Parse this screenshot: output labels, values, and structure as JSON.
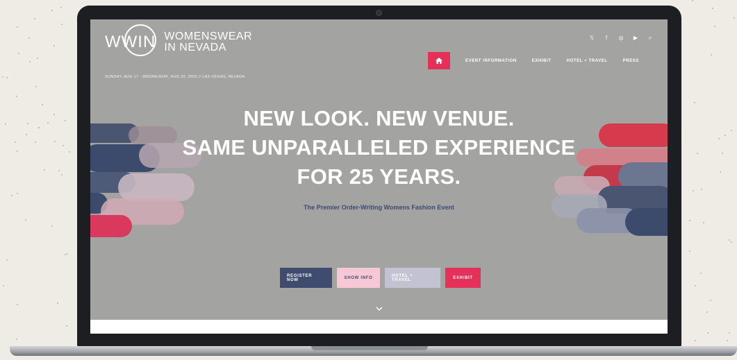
{
  "site": {
    "logo_mark": "WWIN",
    "logo_line1": "WOMENSWEAR",
    "logo_line2": "IN NEVADA",
    "dates": "SUNDAY, AUG 17 - WEDNESDAY, AUG 20, 2025 // LAS VEGAS, NEVADA"
  },
  "social": [
    {
      "name": "x-icon",
      "glyph": "𝕏"
    },
    {
      "name": "facebook-icon",
      "glyph": "f"
    },
    {
      "name": "instagram-icon",
      "glyph": "◎"
    },
    {
      "name": "youtube-icon",
      "glyph": "▶"
    },
    {
      "name": "search-icon",
      "glyph": "⌕"
    }
  ],
  "nav": {
    "home_icon": "home-icon",
    "items": [
      "EVENT INFORMATION",
      "EXHIBIT",
      "HOTEL + TRAVEL",
      "PRESS"
    ]
  },
  "hero": {
    "line1": "NEW LOOK. NEW VENUE.",
    "line2": "SAME UNPARALLELED EXPERIENCE",
    "line3": "FOR 25 YEARS.",
    "subtitle": "The Premier Order-Writing Womens Fashion Event"
  },
  "buttons": [
    {
      "label": "REGISTER NOW",
      "bg": "#3f4c70",
      "color": "#ffffff"
    },
    {
      "label": "SHOW INFO",
      "bg": "#f6c8d6",
      "color": "#3f4c70"
    },
    {
      "label": "HOTEL + TRAVEL",
      "bg": "#c3c2d3",
      "color": "#ffffff"
    },
    {
      "label": "EXHIBIT",
      "bg": "#e5305a",
      "color": "#ffffff"
    }
  ],
  "colors": {
    "accent": "#e5305a",
    "navy": "#3f4c70",
    "hero_bg": "#a3a3a1"
  }
}
